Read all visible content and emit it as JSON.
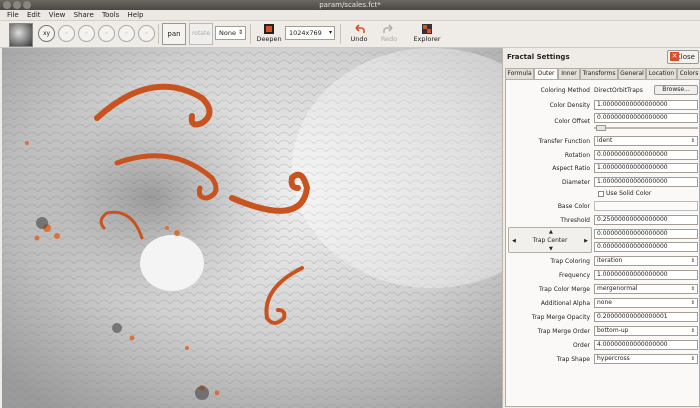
{
  "window": {
    "title": "param/scales.fct*"
  },
  "menu": [
    "File",
    "Edit",
    "View",
    "Share",
    "Tools",
    "Help"
  ],
  "toolbar": {
    "xy_label": "xy",
    "pan_label": "pan",
    "rotate_label": "rotate",
    "filter_value": "None",
    "deepen_label": "Deepen",
    "size_value": "1024x769",
    "undo_label": "Undo",
    "redo_label": "Redo",
    "explorer_label": "Explorer"
  },
  "panel": {
    "title": "Fractal Settings",
    "close_label": "Close",
    "tabs": [
      "Formula",
      "Outer",
      "Inner",
      "Transforms",
      "General",
      "Location",
      "Colors"
    ],
    "selected_tab": "Outer",
    "coloring_method": {
      "label": "Coloring Method",
      "value": "DirectOrbitTraps",
      "browse": "Browse..."
    },
    "color_density": {
      "label": "Color Density",
      "value": "1.00000000000000000"
    },
    "color_offset": {
      "label": "Color Offset",
      "value": "0.00000000000000000"
    },
    "transfer_function": {
      "label": "Transfer Function",
      "value": "ident"
    },
    "rotation": {
      "label": "Rotation",
      "value": "0.00000000000000000"
    },
    "aspect_ratio": {
      "label": "Aspect Ratio",
      "value": "1.00000000000000000"
    },
    "diameter": {
      "label": "Diameter",
      "value": "1.00000000000000000"
    },
    "use_solid_color": {
      "label": "Use Solid Color",
      "checked": false
    },
    "base_color": {
      "label": "Base Color"
    },
    "threshold": {
      "label": "Threshold",
      "value": "0.25000000000000000"
    },
    "trap_center": {
      "label": "Trap Center",
      "x": "0.00000000000000000",
      "y": "0.00000000000000000"
    },
    "trap_coloring": {
      "label": "Trap Coloring",
      "value": "iteration"
    },
    "frequency": {
      "label": "Frequency",
      "value": "1.00000000000000000"
    },
    "trap_color_merge": {
      "label": "Trap Color Merge",
      "value": "mergenormal"
    },
    "additional_alpha": {
      "label": "Additional Alpha",
      "value": "none"
    },
    "trap_merge_opacity": {
      "label": "Trap Merge Opacity",
      "value": "0.20000000000000001"
    },
    "trap_merge_order": {
      "label": "Trap Merge Order",
      "value": "bottom-up"
    },
    "order": {
      "label": "Order",
      "value": "4.00000000000000000"
    },
    "trap_shape": {
      "label": "Trap Shape",
      "value": "hypercross"
    }
  },
  "colors": {
    "accent": "#d5512b",
    "spiral_orange": "#c8531f"
  }
}
